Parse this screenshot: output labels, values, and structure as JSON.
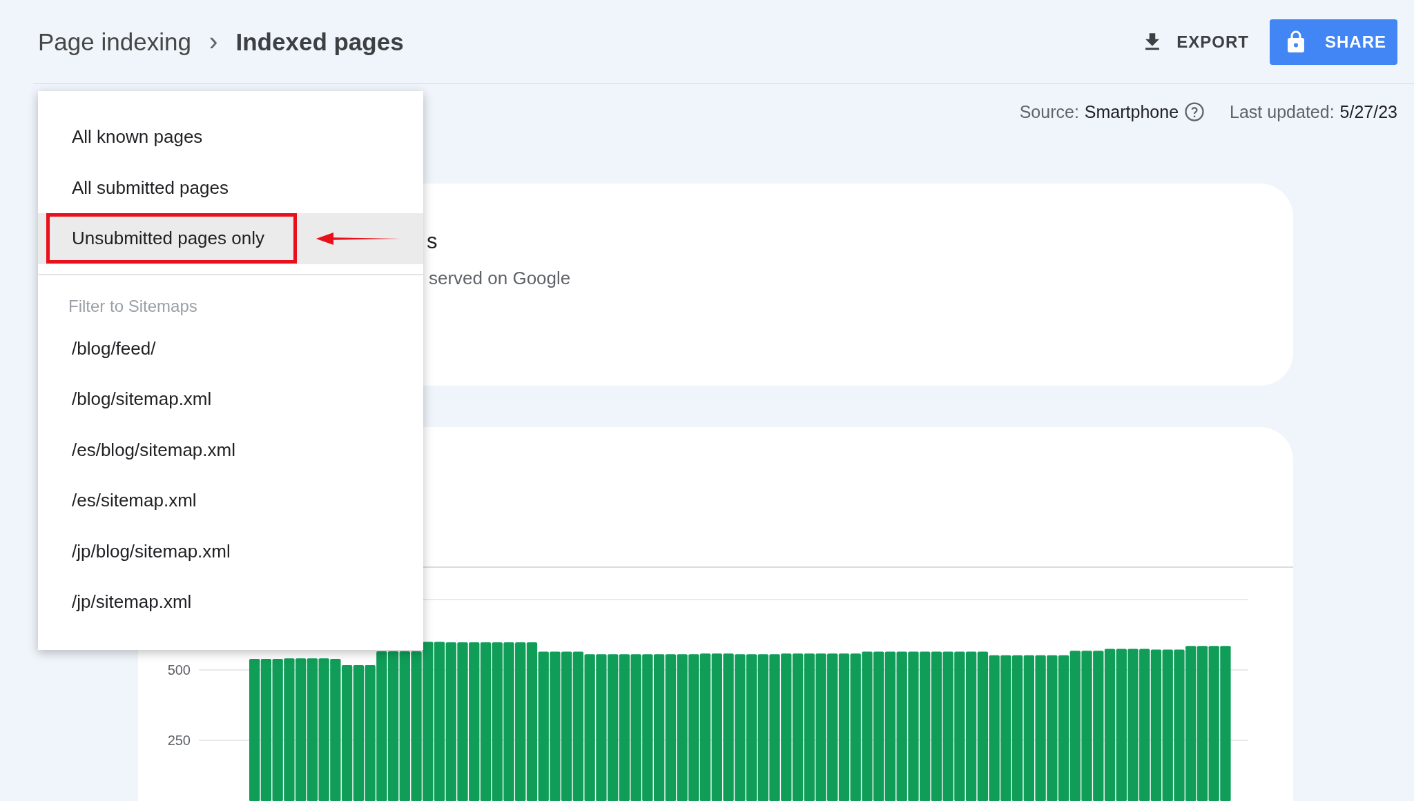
{
  "breadcrumb": {
    "parent": "Page indexing",
    "separator": "›",
    "current": "Indexed pages"
  },
  "actions": {
    "export": "EXPORT",
    "share": "SHARE"
  },
  "meta": {
    "source_label": "Source:",
    "source_value": "Smartphone",
    "updated_label": "Last updated:",
    "updated_value": "5/27/23"
  },
  "summary_card": {
    "title_fragment": "s",
    "subtitle_fragment": "served on Google"
  },
  "dropdown": {
    "items": [
      {
        "label": "All known pages",
        "selected": false,
        "highlighted": false
      },
      {
        "label": "All submitted pages",
        "selected": false,
        "highlighted": false
      },
      {
        "label": "Unsubmitted pages only",
        "selected": true,
        "highlighted": true
      }
    ],
    "section_header": "Filter to Sitemaps",
    "sitemaps": [
      {
        "label": "/blog/feed/",
        "selected": false
      },
      {
        "label": "/blog/sitemap.xml",
        "selected": false
      },
      {
        "label": "/es/blog/sitemap.xml",
        "selected": false
      },
      {
        "label": "/es/sitemap.xml",
        "selected": false
      },
      {
        "label": "/jp/blog/sitemap.xml",
        "selected": false
      },
      {
        "label": "/jp/sitemap.xml",
        "selected": false
      }
    ]
  },
  "chart_card": {
    "chart_data": {
      "type": "bar",
      "ylim": [
        34,
        750
      ],
      "yticks": [
        250,
        500
      ],
      "series": [
        {
          "color": "#0f9d58",
          "values": [
            539,
            539,
            539,
            541,
            541,
            541,
            541,
            539,
            517,
            517,
            517,
            566,
            566,
            566,
            566,
            600,
            600,
            598,
            598,
            598,
            598,
            598,
            598,
            598,
            598,
            565,
            565,
            565,
            565,
            556,
            556,
            556,
            556,
            556,
            556,
            556,
            556,
            556,
            556,
            558,
            558,
            558,
            556,
            556,
            556,
            556,
            558,
            558,
            558,
            558,
            558,
            558,
            558,
            565,
            565,
            565,
            565,
            565,
            565,
            565,
            565,
            565,
            565,
            565,
            552,
            552,
            552,
            552,
            552,
            552,
            552,
            568,
            568,
            568,
            575,
            575,
            575,
            575,
            572,
            572,
            572,
            585,
            585,
            585,
            585
          ]
        }
      ]
    }
  }
}
